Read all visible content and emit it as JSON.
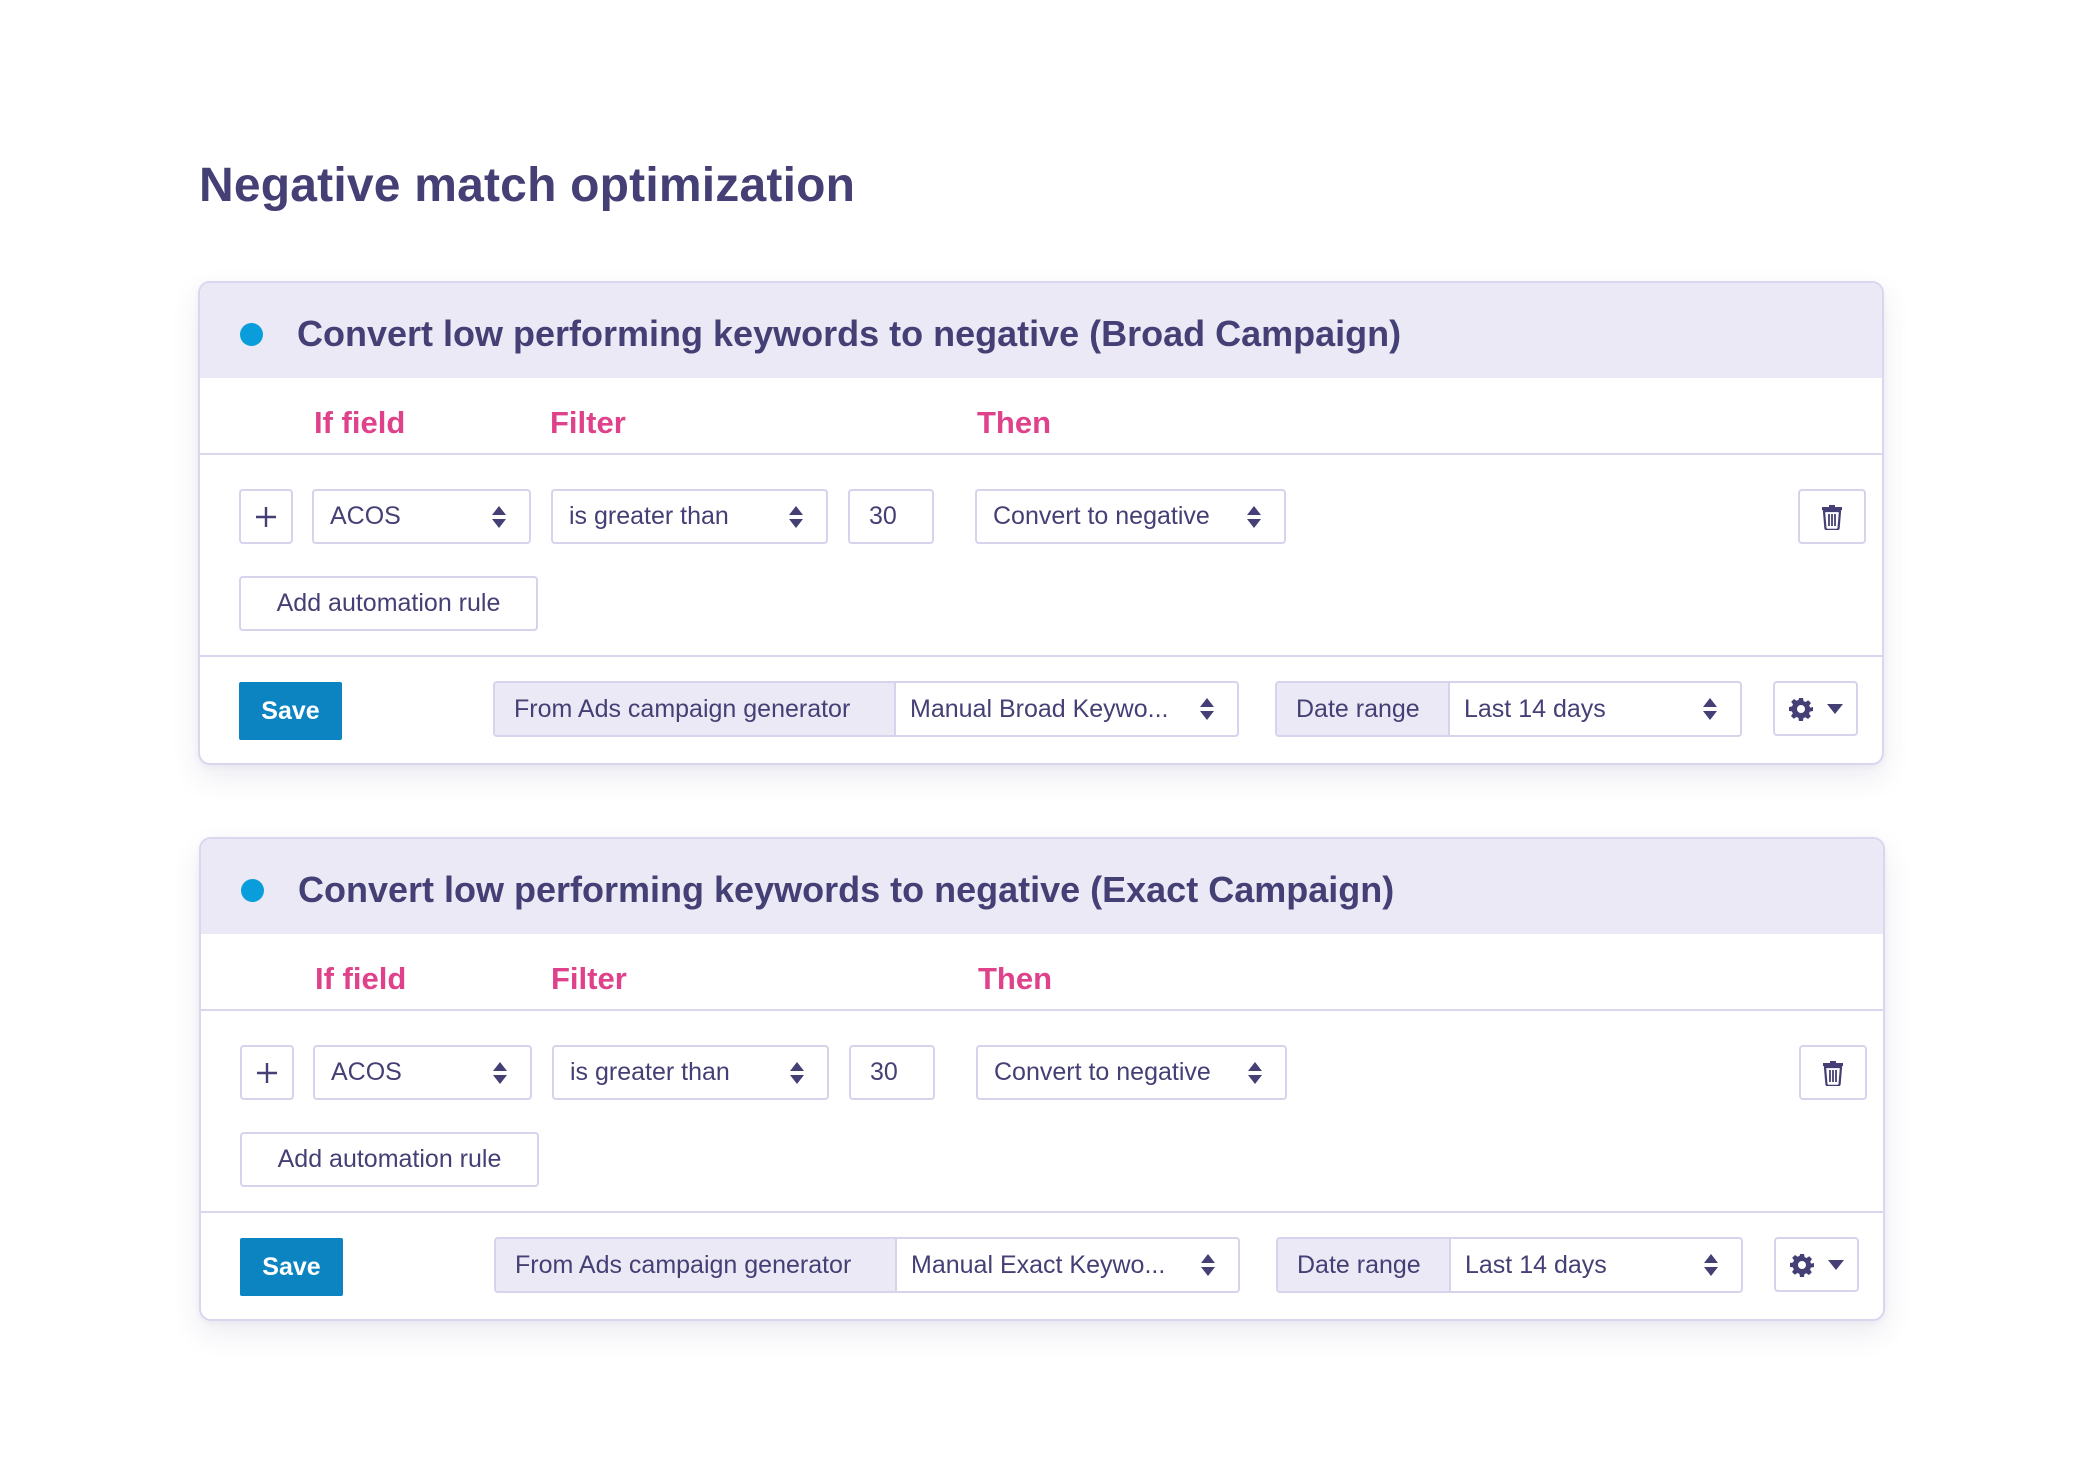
{
  "page": {
    "title": "Negative match optimization"
  },
  "colors": {
    "text": "#443f74",
    "accent_pink": "#e0418b",
    "status_dot": "#0a9ddb",
    "save_button": "#0c84c2",
    "header_bg": "#ebe9f5",
    "border": "#d6d3ec"
  },
  "columns": {
    "if_field": "If field",
    "filter": "Filter",
    "then": "Then"
  },
  "cards": [
    {
      "title": "Convert low performing keywords to negative (Broad Campaign)",
      "status": "active",
      "rule": {
        "field": "ACOS",
        "filter": "is greater than",
        "value": "30",
        "action": "Convert to negative"
      },
      "add_rule_label": "Add automation rule",
      "save_label": "Save",
      "source_label": "From Ads campaign generator",
      "source_value": "Manual Broad Keywo...",
      "date_range_label": "Date range",
      "date_range_value": "Last 14 days"
    },
    {
      "title": "Convert low performing keywords to negative (Exact Campaign)",
      "status": "active",
      "rule": {
        "field": "ACOS",
        "filter": "is greater than",
        "value": "30",
        "action": "Convert to negative"
      },
      "add_rule_label": "Add automation rule",
      "save_label": "Save",
      "source_label": "From Ads campaign generator",
      "source_value": "Manual Exact Keywo...",
      "date_range_label": "Date range",
      "date_range_value": "Last 14 days"
    }
  ],
  "icons": {
    "add": "plus-icon",
    "delete": "trash-icon",
    "settings": "gear-icon",
    "dropdown": "caret-down-icon",
    "select": "up-down-arrows-icon",
    "status": "status-dot-icon"
  }
}
